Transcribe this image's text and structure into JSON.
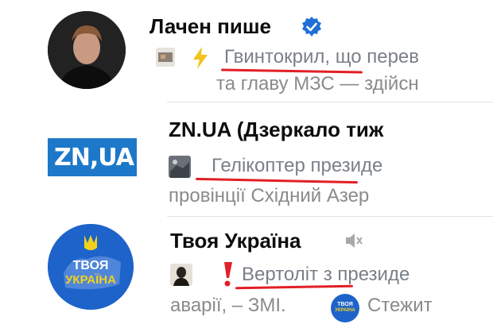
{
  "chats": [
    {
      "name": "Лачен пише",
      "verified": true,
      "line1_prefix_icon": "lightning-icon",
      "line1_highlight": "Гвинтокрил",
      "line1_rest": ", що перев",
      "line2": "та главу МЗС — здійсн"
    },
    {
      "name": "ZN.UA (Дзеркало тиж",
      "avatar_text": "ZN,UA",
      "line1_highlight": "Гелікоптер",
      "line1_rest": " президе",
      "line2": "провінції Східний Азер"
    },
    {
      "name": "Твоя Україна",
      "muted": true,
      "avatar_text_1": "ТВОЯ",
      "avatar_text_2": "УКРАЇНА",
      "line1_prefix_icon": "exclamation-icon",
      "line1_highlight": "Вертоліт",
      "line1_rest": " з президе",
      "line2_start": "аварії, – ЗМІ.",
      "line2_end": "Стежит",
      "inline_logo_text_1": "ТВОЯ",
      "inline_logo_text_2": "УКРАЇНА"
    }
  ],
  "colors": {
    "accent_blue": "#1f6fd6",
    "underline_red": "#e21f26",
    "zn_blue": "#1d78c9",
    "tu_blue": "#1d63c9",
    "tu_yellow": "#f4d21b"
  }
}
